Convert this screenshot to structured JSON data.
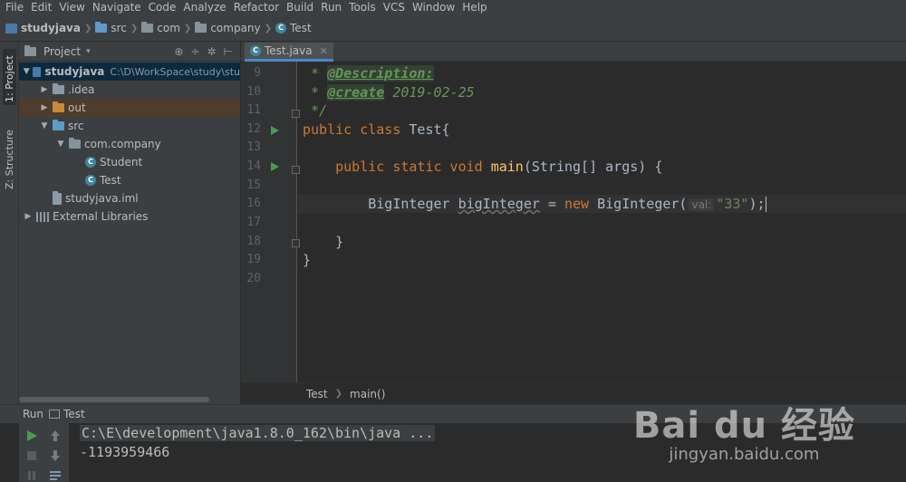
{
  "menu": [
    "File",
    "Edit",
    "View",
    "Navigate",
    "Code",
    "Analyze",
    "Refactor",
    "Build",
    "Run",
    "Tools",
    "VCS",
    "Window",
    "Help"
  ],
  "breadcrumb": [
    "studyjava",
    "src",
    "com",
    "company",
    "Test"
  ],
  "left_strip": {
    "project_tab": "1: Project",
    "structure_tab": "Z: Structure"
  },
  "project_panel": {
    "title": "Project",
    "tree": [
      {
        "label": "studyjava",
        "path": "C:\\D\\WorkSpace\\study\\stu",
        "level": 0,
        "expanded": true,
        "icon": "project-icon"
      },
      {
        "label": ".idea",
        "level": 1,
        "expanded": false,
        "icon": "folder-icon"
      },
      {
        "label": "out",
        "level": 1,
        "expanded": false,
        "icon": "folder-orange-icon"
      },
      {
        "label": "src",
        "level": 1,
        "expanded": true,
        "icon": "folder-blue-icon"
      },
      {
        "label": "com.company",
        "level": 2,
        "expanded": true,
        "icon": "package-icon"
      },
      {
        "label": "Student",
        "level": 3,
        "icon": "class-icon"
      },
      {
        "label": "Test",
        "level": 3,
        "icon": "class-icon"
      },
      {
        "label": "studyjava.iml",
        "level": 1,
        "icon": "iml-file-icon"
      },
      {
        "label": "External Libraries",
        "level": 0,
        "expanded": false,
        "icon": "libraries-icon"
      }
    ]
  },
  "editor": {
    "tab": "Test.java",
    "line_numbers": [
      "9",
      "10",
      "11",
      "12",
      "13",
      "14",
      "15",
      "16",
      "17",
      "18",
      "19",
      "20"
    ],
    "code": {
      "l9_prefix": " * ",
      "l9_tag": "@Description:",
      "l10_prefix": " * ",
      "l10_tag": "@create",
      "l10_value": " 2019-02-25",
      "l11": " */",
      "l12_kw": "public class",
      "l12_rest": " Test{",
      "l14_kw": "public static void",
      "l14_fn": "main",
      "l14_rest": "(String[] args) {",
      "l16_type": "BigInteger ",
      "l16_var": "bigInteger",
      "l16_eq": " = ",
      "l16_kw": "new",
      "l16_call": " BigInteger(",
      "l16_hint": "val:",
      "l16_str": "\"33\"",
      "l16_end": ");",
      "l18": "}",
      "l19": "}"
    },
    "breadcrumb": [
      "Test",
      "main()"
    ]
  },
  "run_panel": {
    "label": "Run",
    "config": "Test",
    "output": [
      "C:\\E\\development\\java1.8.0_162\\bin\\java ...",
      "-1193959466"
    ]
  },
  "watermark": {
    "brand": "Bai du 经验",
    "url": "jingyan.baidu.com"
  }
}
